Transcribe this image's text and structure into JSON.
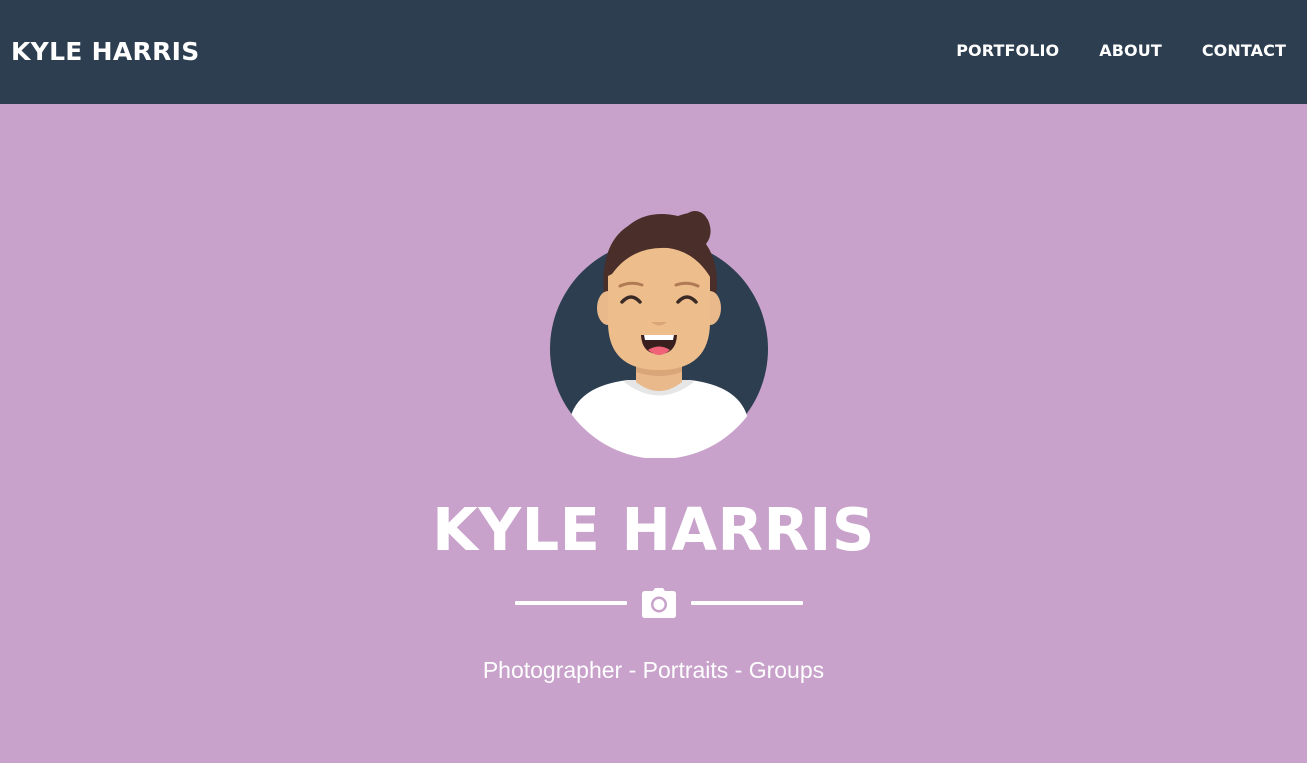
{
  "navbar": {
    "brand": "KYLE HARRIS",
    "links": [
      {
        "label": "PORTFOLIO"
      },
      {
        "label": "ABOUT"
      },
      {
        "label": "CONTACT"
      }
    ]
  },
  "masthead": {
    "avatar_icon": "avatar-icon",
    "title": "KYLE HARRIS",
    "divider_icon": "camera-icon",
    "subheading": "Photographer - Portraits - Groups"
  },
  "colors": {
    "navbar_bg": "#2c3e50",
    "masthead_bg": "#c8a2cb",
    "text": "#ffffff"
  }
}
